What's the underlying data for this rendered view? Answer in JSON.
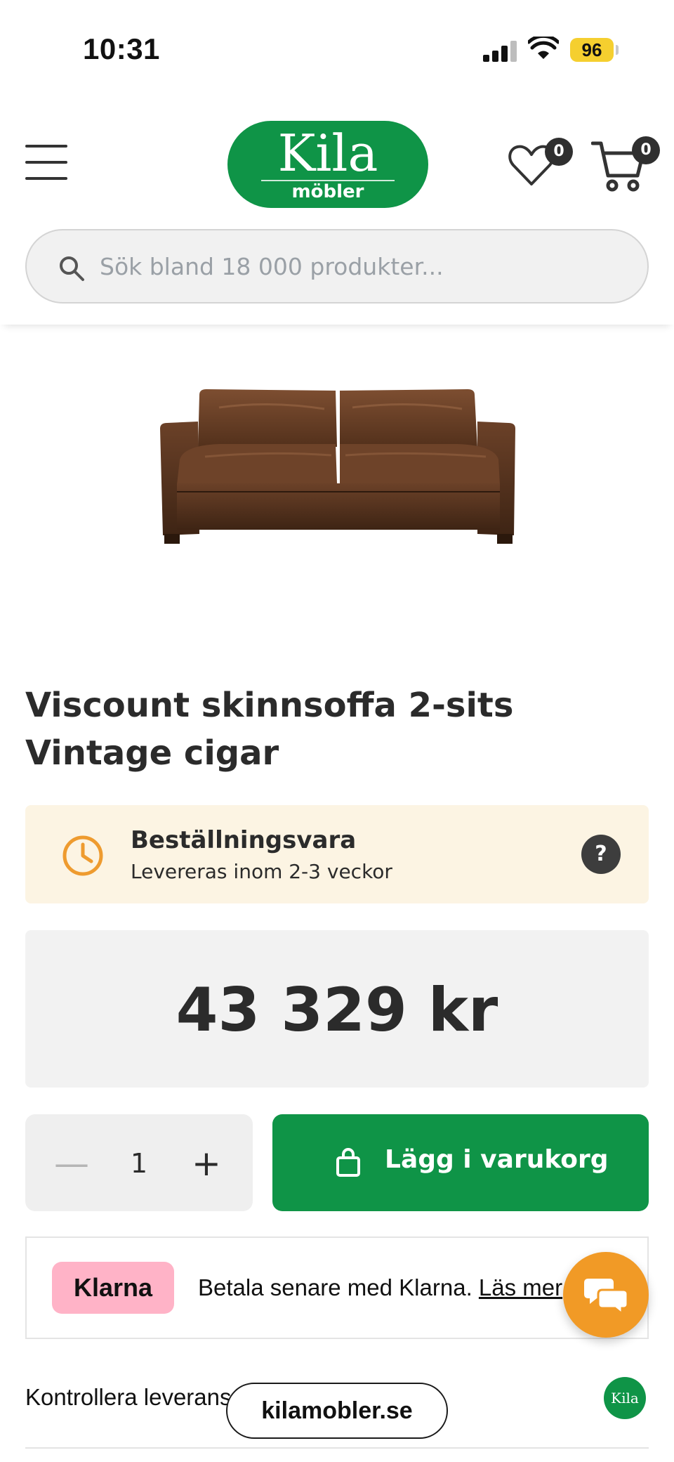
{
  "status_bar": {
    "time": "10:31",
    "battery": "96"
  },
  "header": {
    "logo_main": "Kila",
    "logo_sub": "möbler",
    "wishlist_count": "0",
    "cart_count": "0",
    "search_placeholder": "Sök bland 18 000 produkter..."
  },
  "product": {
    "title": "Viscount skinnsoffa 2-sits Vintage cigar",
    "availability_title": "Beställningsvara",
    "availability_sub": "Levereras inom 2-3 veckor",
    "help_label": "?",
    "price": "43 329 kr",
    "quantity": "1",
    "add_to_cart": "Lägg i varukorg"
  },
  "klarna": {
    "badge": "Klarna",
    "text": "Betala senare med Klarna. ",
    "link": "Läs mer"
  },
  "delivery": {
    "label": "Kontrollera leveransmöjligheter",
    "mini_logo": "Kila"
  },
  "browser": {
    "url": "kilamobler.se"
  },
  "colors": {
    "brand_green": "#0f9447",
    "chat_orange": "#f19a26",
    "klarna_pink": "#ffb3c7",
    "availability_bg": "#fcf4e3"
  },
  "icons": [
    "menu-icon",
    "heart-icon",
    "cart-icon",
    "search-icon",
    "clock-icon",
    "help-icon",
    "minus-icon",
    "plus-icon",
    "bag-icon",
    "chat-icon"
  ]
}
